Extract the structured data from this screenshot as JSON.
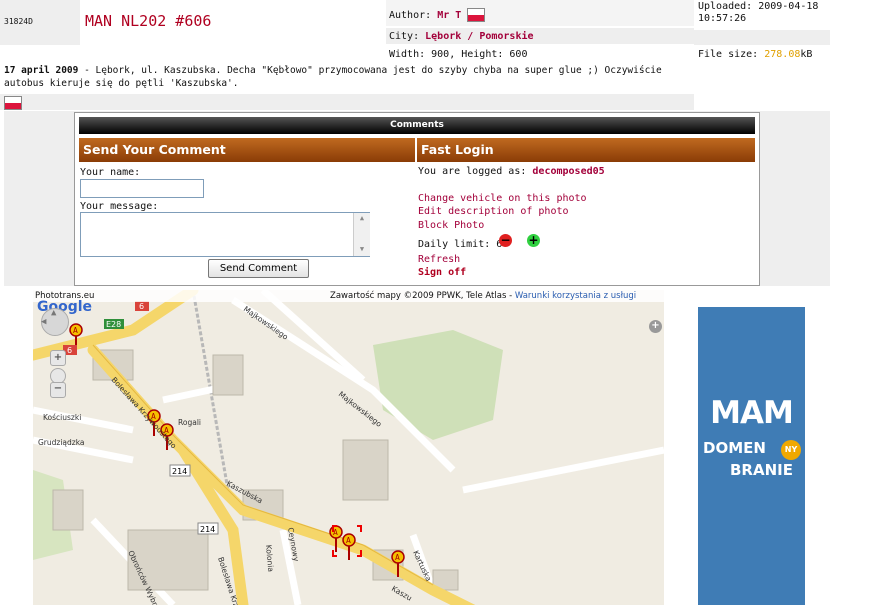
{
  "photo": {
    "id": "31824D",
    "title": "MAN NL202 #606",
    "author_label": "Author:",
    "author": "Mr T",
    "city_label": "City:",
    "city": "Lębork / Pomorskie",
    "dimensions": "Width: 900, Height: 600",
    "uploaded": "Uploaded: 2009-04-18 10:57:26",
    "file_size_label": "File size:",
    "file_size": "278.08",
    "file_size_unit": "kB",
    "desc_date": "17 april 2009",
    "description": " - Lębork, ul. Kaszubska. Decha \"Kębłowo\" przymocowana jest do szyby chyba na super glue ;) Oczywiście autobus kieruje się do pętli 'Kaszubska'."
  },
  "comments": {
    "header": "Comments",
    "send_title": "Send Your Comment",
    "name_label": "Your name:",
    "message_label": "Your message:",
    "send_button": "Send Comment"
  },
  "login": {
    "title": "Fast Login",
    "logged_as_label": "You are logged as:",
    "username": "decomposed05",
    "change_vehicle": "Change vehicle on this photo",
    "edit_desc": "Edit description of photo",
    "block_photo": "Block Photo",
    "daily_limit_label": "Daily limit:",
    "daily_limit": "6",
    "refresh": "Refresh",
    "sign_off": "Sign off"
  },
  "map": {
    "site_label": "Phototrans.eu",
    "copyright": "Zawartość mapy ©2009 PPWK, Tele Atlas",
    "terms": "Warunki korzystania z usługi",
    "logo": "Google",
    "streets": {
      "majkowskiego1": "Majkowskiego",
      "majkowskiego2": "Majkowskiego",
      "kosciuszki": "Kościuszki",
      "grudziadzka": "Grudziądzka",
      "rogali": "Rogali",
      "boleslawa": "Bolesława Krzywoustego",
      "kaszubska": "Kaszubska",
      "kaszubska2": "Kaszu",
      "ceynowy": "Ceynowy",
      "kolonia": "Kolonia",
      "obroncow": "Obrońców Wybrzeża",
      "kartuska": "Kartuska",
      "boleslawa2": "Bolesława Krzyw"
    },
    "badges": {
      "e28": "E28",
      "six_a": "6",
      "six_b": "6",
      "r214a": "214",
      "r214b": "214"
    }
  },
  "ad": {
    "line1": "MAM",
    "line2": "DOMEN",
    "badge": "NY",
    "line3": "BRANIE"
  },
  "colors": {
    "accent_red": "#b00020",
    "link": "#a3003a",
    "orange": "#c06a20",
    "ad_blue": "#3f7cb5",
    "file_size": "#e0a000"
  }
}
